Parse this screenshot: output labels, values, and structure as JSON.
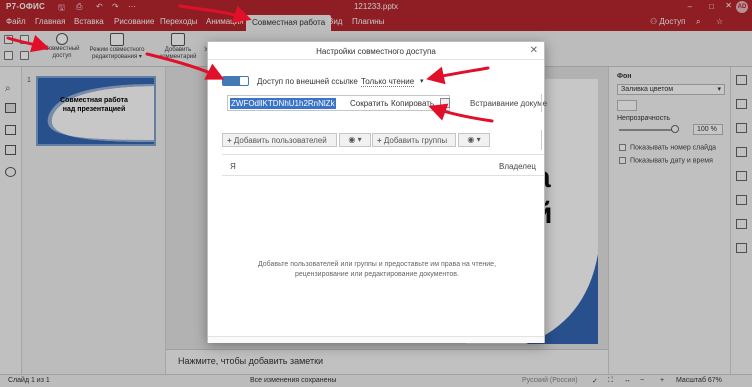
{
  "app": {
    "logo": "Р7-ОФИС",
    "doc_title": "121233.pptx",
    "user_initials": "AD",
    "access_label": "Доступ"
  },
  "menu": {
    "tabs": [
      "Файл",
      "Главная",
      "Вставка",
      "Рисование",
      "Переходы",
      "Анимация",
      "Совместная работа",
      "Вид",
      "Плагины"
    ],
    "active_tab": "Совместная работа"
  },
  "toolbar": {
    "coedit_access_l1": "Совместный",
    "coedit_access_l2": "доступ",
    "coedit_mode_l1": "Режим совместного",
    "coedit_mode_l2": "редактирования ▾",
    "add_comment_l1": "Добавить",
    "add_comment_l2": "комментарий",
    "partial_label": "У"
  },
  "slides": {
    "number": "1",
    "thumb_title": "Совместная работа над презентацией"
  },
  "editor": {
    "visible_letters": [
      "а",
      "й"
    ],
    "notes_placeholder": "Нажмите, чтобы добавить заметки"
  },
  "right_panel": {
    "background_label": "Фон",
    "fill_value": "Заливка цветом",
    "opacity_label": "Непрозрачность",
    "opacity_value": "100 %",
    "show_slide_number": "Показывать номер слайда",
    "show_date_time": "Показывать дату и время"
  },
  "status": {
    "slide_counter": "Слайд 1 из 1",
    "saved": "Все изменения сохранены",
    "language": "Русский (Россия)",
    "zoom": "Масштаб 67%"
  },
  "dialog": {
    "title": "Настройки совместного доступа",
    "external_access_label": "Доступ по внешней ссылке",
    "access_level": "Только чтение",
    "link_value": "ZWFOdllKTDNhU1h2RnNlZk",
    "shorten": "Сократить",
    "copy": "Копировать",
    "embed_tab": "Встраивание докуме",
    "add_users": "Добавить пользователей",
    "add_groups": "Добавить группы",
    "col_name": "Я",
    "col_owner": "Владелец",
    "empty_message": "Добавьте пользователей или группы и предоставьте им права на чтение, рецензирование или редактирование документов."
  },
  "colors": {
    "brand": "#b7272d",
    "toggle_on": "#4479b4",
    "selection": "#3a74c9",
    "arrow": "#e0102a"
  }
}
